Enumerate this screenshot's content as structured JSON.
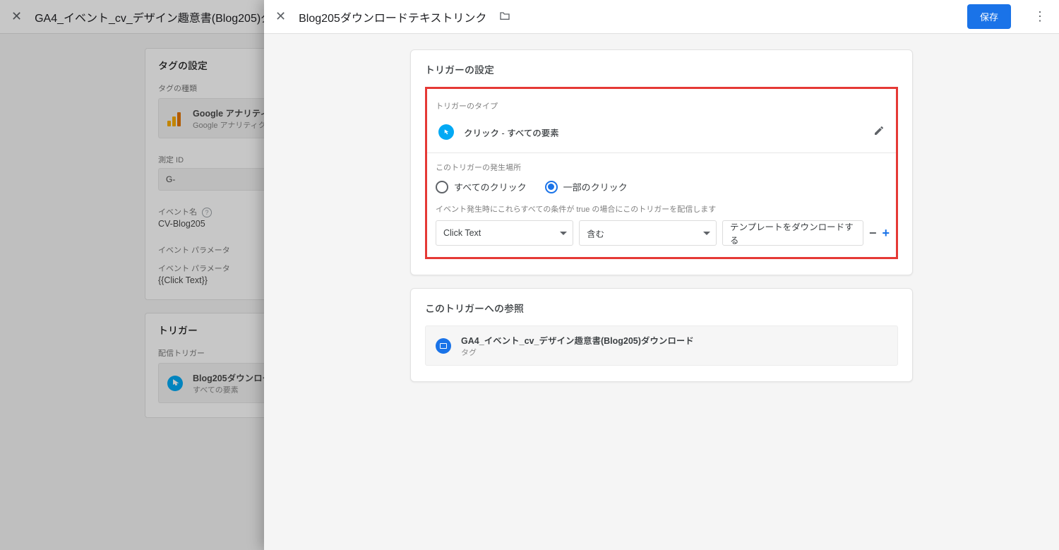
{
  "back": {
    "title": "GA4_イベント_cv_デザイン趣意書(Blog205)ダ",
    "card_tag": {
      "heading": "タグの設定",
      "type_label": "タグの種類",
      "type_title": "Google アナリティ",
      "type_desc": "Google アナリティク",
      "measure_label": "測定 ID",
      "measure_value": "G-",
      "event_name_label": "イベント名",
      "event_name_value": "CV-Blog205",
      "event_param_label": "イベント パラメータ",
      "event_param_sub": "イベント パラメータ",
      "event_param_value": "{{Click Text}}"
    },
    "card_trigger": {
      "heading": "トリガー",
      "fire_label": "配信トリガー",
      "item_title": "Blog205ダウンロー",
      "item_desc": "すべての要素"
    }
  },
  "front": {
    "title": "Blog205ダウンロードテキストリンク",
    "save_label": "保存",
    "config_card": {
      "heading": "トリガーの設定",
      "type_label": "トリガーのタイプ",
      "type_value": "クリック - すべての要素",
      "fires_label": "このトリガーの発生場所",
      "radios": {
        "all": "すべてのクリック",
        "some": "一部のクリック"
      },
      "condition_label": "イベント発生時にこれらすべての条件が true の場合にこのトリガーを配信します",
      "condition": {
        "var": "Click Text",
        "op": "含む",
        "value": "テンプレートをダウンロードする",
        "minus": "−",
        "plus": "+"
      }
    },
    "refs_card": {
      "heading": "このトリガーへの参照",
      "item_title": "GA4_イベント_cv_デザイン趣意書(Blog205)ダウンロード",
      "item_sub": "タグ"
    }
  }
}
